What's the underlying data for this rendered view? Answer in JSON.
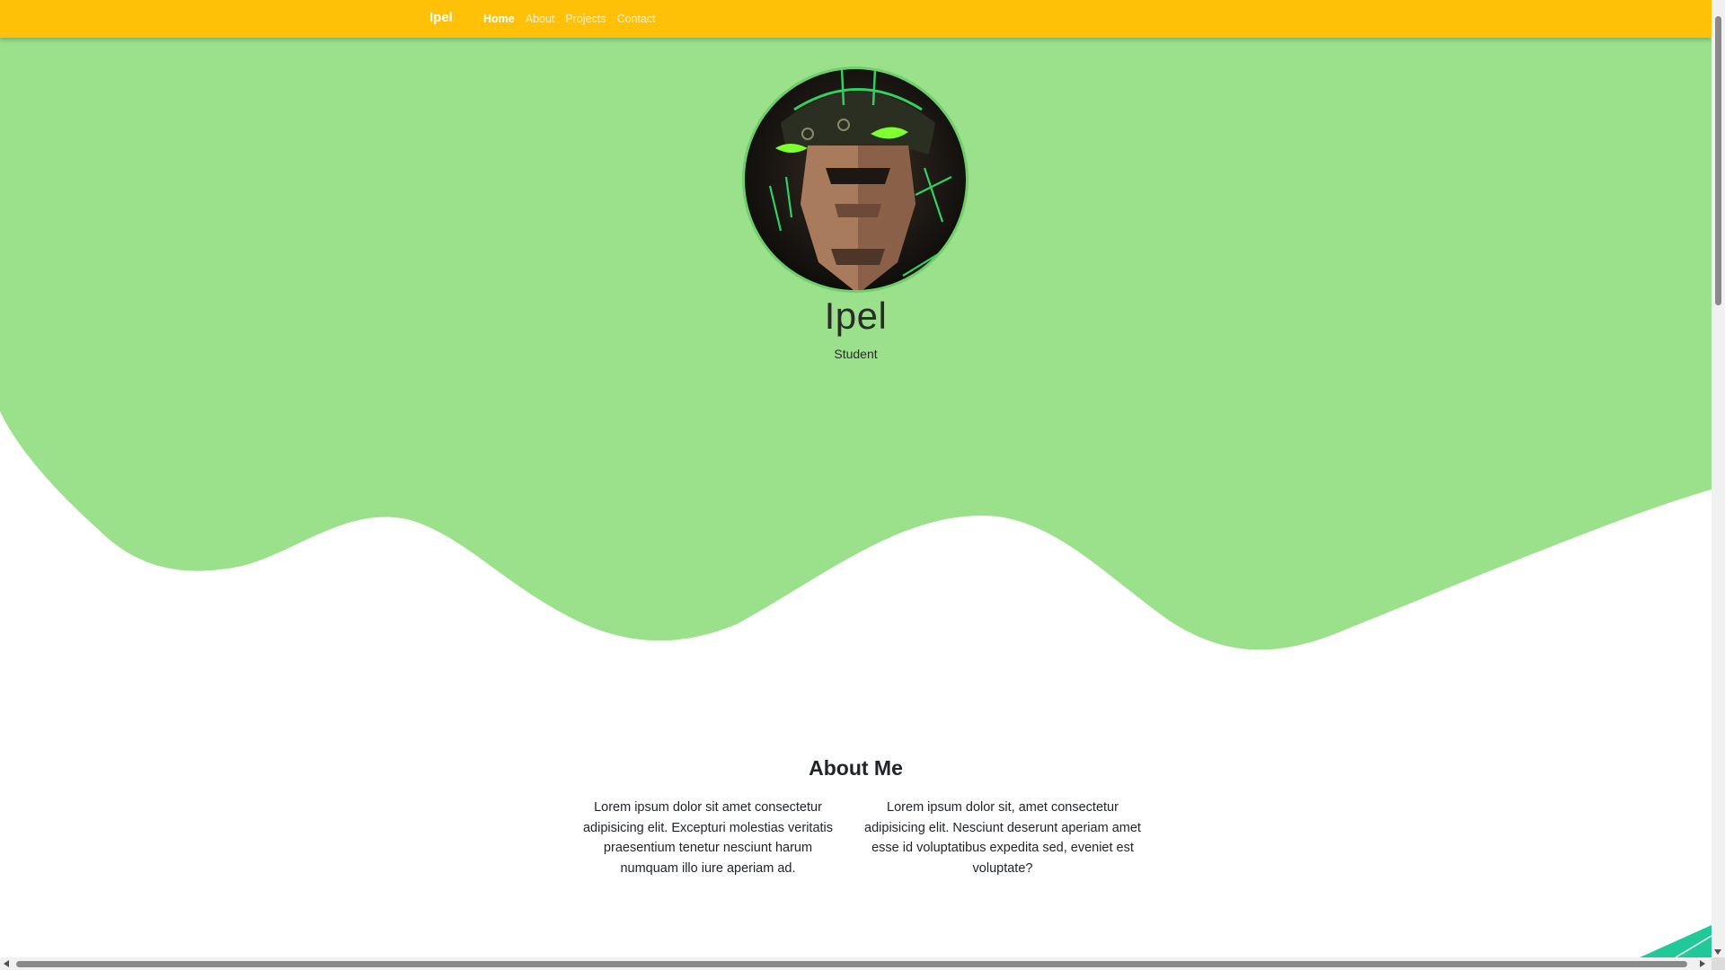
{
  "colors": {
    "navbar": "#ffc107",
    "hero": "#9be08b",
    "accent_corner": "#20c997",
    "text": "#212529"
  },
  "navbar": {
    "brand": "Ipel",
    "links": [
      {
        "label": "Home",
        "active": true
      },
      {
        "label": "About",
        "active": false
      },
      {
        "label": "Projects",
        "active": false
      },
      {
        "label": "Contact",
        "active": false
      }
    ]
  },
  "hero": {
    "avatar_icon": "profile-avatar",
    "name": "Ipel",
    "role": "Student"
  },
  "about": {
    "title": "About Me",
    "paragraphs": [
      "Lorem ipsum dolor sit amet consectetur adipisicing elit. Excepturi molestias veritatis praesentium tenetur nesciunt harum numquam illo iure aperiam ad.",
      "Lorem ipsum dolor sit, amet consectetur adipisicing elit. Nesciunt deserunt aperiam amet esse id voluptatibus expedita sed, eveniet est voluptate?"
    ]
  }
}
